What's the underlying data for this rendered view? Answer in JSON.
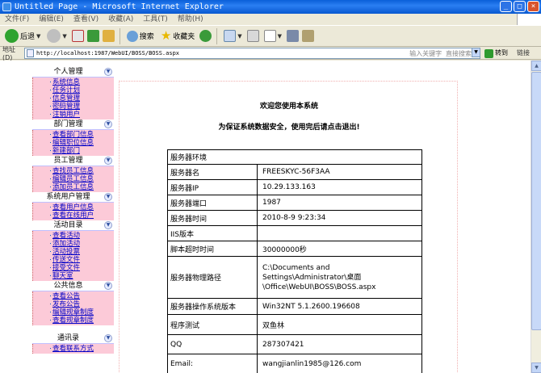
{
  "window": {
    "title": "Untitled Page - Microsoft Internet Explorer",
    "buttons": {
      "minimize": "_",
      "maximize": "□",
      "close": "×"
    }
  },
  "menu": [
    "文件(F)",
    "编辑(E)",
    "查看(V)",
    "收藏(A)",
    "工具(T)",
    "帮助(H)"
  ],
  "toolbar": {
    "back_label": "后退",
    "search_label": "搜索",
    "favorites_label": "收藏夹"
  },
  "address": {
    "label": "地址(D)",
    "url": "http://localhost:1987/WebUI/BOSS/BOSS.aspx",
    "search_hint": "输入关键字 直接搜索",
    "go_label": "转到",
    "links_label": "链接"
  },
  "sidebar": {
    "sections": [
      {
        "title": "个人管理",
        "items": [
          "系统信息",
          "任务计划",
          "信息管理",
          "密码管理",
          "注销用户"
        ]
      },
      {
        "title": "部门管理",
        "items": [
          "查看部门信息",
          "编辑职位信息",
          "新建部门"
        ]
      },
      {
        "title": "员工管理",
        "items": [
          "查找员工信息",
          "编辑员工信息",
          "添加员工信息"
        ]
      },
      {
        "title": "系统用户管理",
        "items": [
          "查看用户信息",
          "查看在线用户"
        ]
      },
      {
        "title": "活动目录",
        "items": [
          "查看活动",
          "添加活动",
          "活动投票",
          "传送文件",
          "接受文件",
          "聊天室"
        ]
      },
      {
        "title": "公共信息",
        "items": [
          "查看公告",
          "发布公告",
          "编辑规章制度",
          "查看规章制度"
        ]
      },
      {
        "title": "通讯录",
        "items": [
          "查看联系方式"
        ]
      }
    ]
  },
  "main": {
    "welcome": "欢迎您使用本系统",
    "notice": "为保证系统数据安全，使用完后请点击退出!",
    "table": {
      "header": "服务器环境",
      "rows": [
        {
          "key": "服务器名",
          "value": "FREESKYC-56F3AA"
        },
        {
          "key": "服务器IP",
          "value": "10.29.133.163"
        },
        {
          "key": "服务器端口",
          "value": "1987"
        },
        {
          "key": "服务器时间",
          "value": "2010-8-9 9:23:34"
        },
        {
          "key": "IIS版本",
          "value": ""
        },
        {
          "key": "脚本超时时间",
          "value": "30000000秒"
        },
        {
          "key": "服务器物理路径",
          "value": "C:\\Documents and Settings\\Administrator\\桌面\\Office\\WebUI\\BOSS\\BOSS.aspx"
        },
        {
          "key": "服务器操作系统版本",
          "value": "Win32NT 5.1.2600.196608"
        },
        {
          "key": "程序测试",
          "value": "双鱼林"
        },
        {
          "key": "QQ",
          "value": "287307421"
        },
        {
          "key": "Email:",
          "value": "wangjianlin1985@126.com"
        }
      ]
    }
  }
}
